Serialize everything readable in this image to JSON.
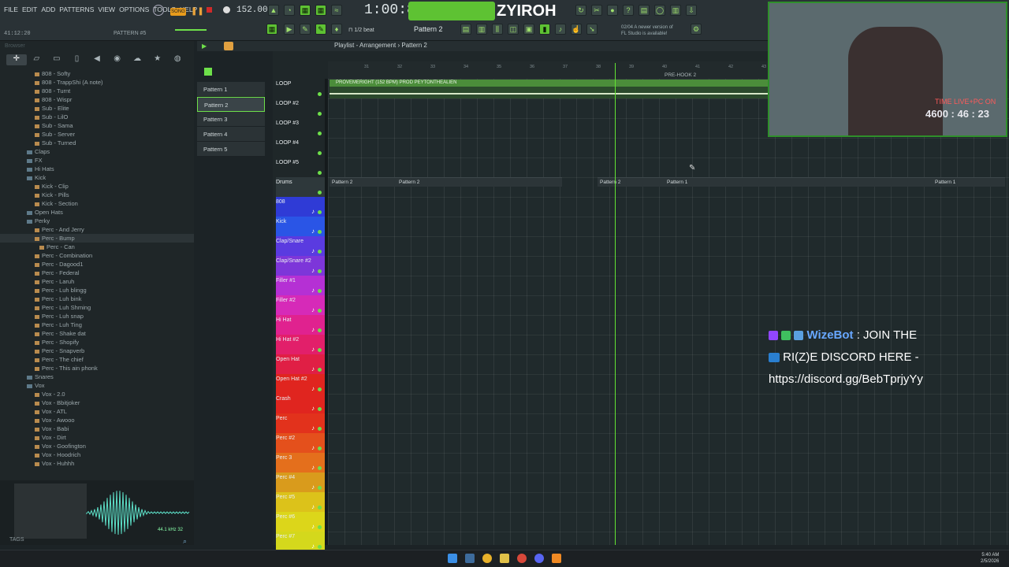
{
  "menu": [
    "FILE",
    "EDIT",
    "ADD",
    "PATTERNS",
    "VIEW",
    "OPTIONS",
    "TOOLS",
    "HELP"
  ],
  "transport": {
    "mode": "SONG",
    "bpm": "152.000",
    "time": "1:00:87",
    "clock": "41:12:20",
    "pattern_small": "PATTERN #5"
  },
  "logo_text": "ZYIROH",
  "hint": {
    "line1": "02/04 A newer version of",
    "line2": "FL Studio is available!"
  },
  "snap_label": "1/2 beat",
  "pattern_selector": "Pattern 2",
  "browser_label": "Browser",
  "playlist_title": "Playlist - Arrangement › Pattern 2",
  "browser_tree": [
    {
      "label": "808 - Softy",
      "type": "file",
      "indent": 44
    },
    {
      "label": "808 - TrappShi (A note)",
      "type": "file",
      "indent": 44
    },
    {
      "label": "808 - Turnt",
      "type": "file",
      "indent": 44
    },
    {
      "label": "808 - Wispr",
      "type": "file",
      "indent": 44
    },
    {
      "label": "Sub - Elite",
      "type": "file",
      "indent": 44
    },
    {
      "label": "Sub - LilO",
      "type": "file",
      "indent": 44
    },
    {
      "label": "Sub - Sama",
      "type": "file",
      "indent": 44
    },
    {
      "label": "Sub - Server",
      "type": "file",
      "indent": 44
    },
    {
      "label": "Sub - Turned",
      "type": "file",
      "indent": 44
    },
    {
      "label": "Claps",
      "type": "folder",
      "indent": 34
    },
    {
      "label": "FX",
      "type": "folder",
      "indent": 34
    },
    {
      "label": "Hi Hats",
      "type": "folder",
      "indent": 34
    },
    {
      "label": "Kick",
      "type": "folder",
      "indent": 34
    },
    {
      "label": "Kick - Clip",
      "type": "file",
      "indent": 44
    },
    {
      "label": "Kick - Pills",
      "type": "file",
      "indent": 44
    },
    {
      "label": "Kick - Section",
      "type": "file",
      "indent": 44
    },
    {
      "label": "Open Hats",
      "type": "folder",
      "indent": 34
    },
    {
      "label": "Perky",
      "type": "folder",
      "indent": 34
    },
    {
      "label": "Perc - And Jerry",
      "type": "file",
      "indent": 44
    },
    {
      "label": "Perc - Bump",
      "type": "file",
      "indent": 44,
      "sel": true
    },
    {
      "label": "Perc - Can",
      "type": "file",
      "indent": 50
    },
    {
      "label": "Perc - Combination",
      "type": "file",
      "indent": 44
    },
    {
      "label": "Perc - Dagood1",
      "type": "file",
      "indent": 44
    },
    {
      "label": "Perc - Federal",
      "type": "file",
      "indent": 44
    },
    {
      "label": "Perc - Laruh",
      "type": "file",
      "indent": 44
    },
    {
      "label": "Perc - Luh blingg",
      "type": "file",
      "indent": 44
    },
    {
      "label": "Perc - Luh bink",
      "type": "file",
      "indent": 44
    },
    {
      "label": "Perc - Luh Shming",
      "type": "file",
      "indent": 44
    },
    {
      "label": "Perc - Luh snap",
      "type": "file",
      "indent": 44
    },
    {
      "label": "Perc - Luh Ting",
      "type": "file",
      "indent": 44
    },
    {
      "label": "Perc - Shake dat",
      "type": "file",
      "indent": 44
    },
    {
      "label": "Perc - Shopify",
      "type": "file",
      "indent": 44
    },
    {
      "label": "Perc - Snapverb",
      "type": "file",
      "indent": 44
    },
    {
      "label": "Perc - The chief",
      "type": "file",
      "indent": 44
    },
    {
      "label": "Perc - This ain phonk",
      "type": "file",
      "indent": 44
    },
    {
      "label": "Snares",
      "type": "folder",
      "indent": 34
    },
    {
      "label": "Vox",
      "type": "folder",
      "indent": 34
    },
    {
      "label": "Vox - 2.0",
      "type": "file",
      "indent": 44
    },
    {
      "label": "Vox - Bbitjoker",
      "type": "file",
      "indent": 44
    },
    {
      "label": "Vox - ATL",
      "type": "file",
      "indent": 44
    },
    {
      "label": "Vox - Awooo",
      "type": "file",
      "indent": 44
    },
    {
      "label": "Vox - Babi",
      "type": "file",
      "indent": 44
    },
    {
      "label": "Vox - Dirt",
      "type": "file",
      "indent": 44
    },
    {
      "label": "Vox - Goofington",
      "type": "file",
      "indent": 44
    },
    {
      "label": "Vox - Hoodrich",
      "type": "file",
      "indent": 44
    },
    {
      "label": "Vox - Huhhh",
      "type": "file",
      "indent": 44
    }
  ],
  "wave_info": "44.1 kHz 32",
  "tags_label": "TAGS",
  "patterns": [
    "Pattern 1",
    "Pattern 2",
    "Pattern 3",
    "Pattern 4",
    "Pattern 5"
  ],
  "tracks": [
    {
      "label": "LOOP",
      "color": "#1f2729"
    },
    {
      "label": "LOOP #2",
      "color": "#1f2729"
    },
    {
      "label": "LOOP #3",
      "color": "#1f2729"
    },
    {
      "label": "LOOP #4",
      "color": "#1f2729"
    },
    {
      "label": "LOOP #5",
      "color": "#1f2729"
    },
    {
      "label": "Drums",
      "color": "#2e383b"
    },
    {
      "label": "808",
      "color": "#2f3bd6"
    },
    {
      "label": "Kick",
      "color": "#2a55e6"
    },
    {
      "label": "Clap/Snare",
      "color": "#5a3be0"
    },
    {
      "label": "Clap/Snare #2",
      "color": "#7d36d9"
    },
    {
      "label": "Filler #1",
      "color": "#b530d4"
    },
    {
      "label": "Filler #2",
      "color": "#d62ab8"
    },
    {
      "label": "Hi Hat",
      "color": "#e0228f"
    },
    {
      "label": "Hi Hat #2",
      "color": "#e21f6a"
    },
    {
      "label": "Open Hat",
      "color": "#e01f45"
    },
    {
      "label": "Open Hat #2",
      "color": "#e0251f"
    },
    {
      "label": "Crash",
      "color": "#e0251f"
    },
    {
      "label": "Perc",
      "color": "#e2321c"
    },
    {
      "label": "Perc #2",
      "color": "#e4501c"
    },
    {
      "label": "Perc 3",
      "color": "#e46f1c"
    },
    {
      "label": "Perc #4",
      "color": "#d99b1c"
    },
    {
      "label": "Perc #5",
      "color": "#dcc21a"
    },
    {
      "label": "Perc #6",
      "color": "#dcd61a"
    },
    {
      "label": "Perc #7",
      "color": "#d4d81c"
    }
  ],
  "ruler_marks": [
    "31",
    "32",
    "33",
    "34",
    "35",
    "36",
    "37",
    "38",
    "39",
    "40",
    "41",
    "42",
    "43"
  ],
  "marker": "PRE-HOOK 2",
  "audio_clip": "PROVEMERIGHT (152 BPM) PROD PEYTONTHEALIEN",
  "drum_clips": [
    "Pattern 2",
    "Pattern 2",
    "Pattern 2",
    "Pattern 1",
    "Pattern 1"
  ],
  "webcam_overlay": {
    "text": "TIME LIVE+PC ON",
    "counter": "4600 : 46 : 23"
  },
  "bot": {
    "name": "WizeBot",
    "line1": ": JOIN THE",
    "line2": "RI(Z)E DISCORD HERE -",
    "url": "https://discord.gg/BebTprjyYy"
  },
  "taskbar": {
    "time": "5:40 AM",
    "date": "2/5/2026"
  },
  "accent": "#63e334"
}
